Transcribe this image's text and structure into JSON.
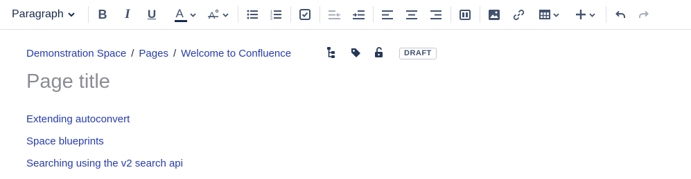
{
  "toolbar": {
    "paragraph_style": "Paragraph",
    "bold_label": "B",
    "italic_label": "I",
    "underline_label": "U",
    "text_color_label": "A",
    "text_color_accent": "#172b4d",
    "icons": [
      "chevron-down-icon",
      "bold-icon",
      "italic-icon",
      "underline-icon",
      "text-color-icon",
      "clear-format-icon",
      "bullet-list-icon",
      "numbered-list-icon",
      "task-list-icon",
      "outdent-icon",
      "indent-icon",
      "align-left-icon",
      "align-center-icon",
      "align-right-icon",
      "layouts-icon",
      "image-icon",
      "link-icon",
      "table-icon",
      "plus-icon",
      "undo-icon",
      "redo-icon"
    ]
  },
  "breadcrumbs": [
    "Demonstration Space",
    "Pages",
    "Welcome to Confluence"
  ],
  "breadcrumb_separator": "/",
  "status_badge": "DRAFT",
  "title_placeholder": "Page title",
  "content_links": [
    "Extending autoconvert",
    "Space blueprints",
    "Searching using the v2 search api"
  ],
  "colors": {
    "link": "#253bb2",
    "icon": "#42526e",
    "placeholder": "#8b8d93"
  }
}
